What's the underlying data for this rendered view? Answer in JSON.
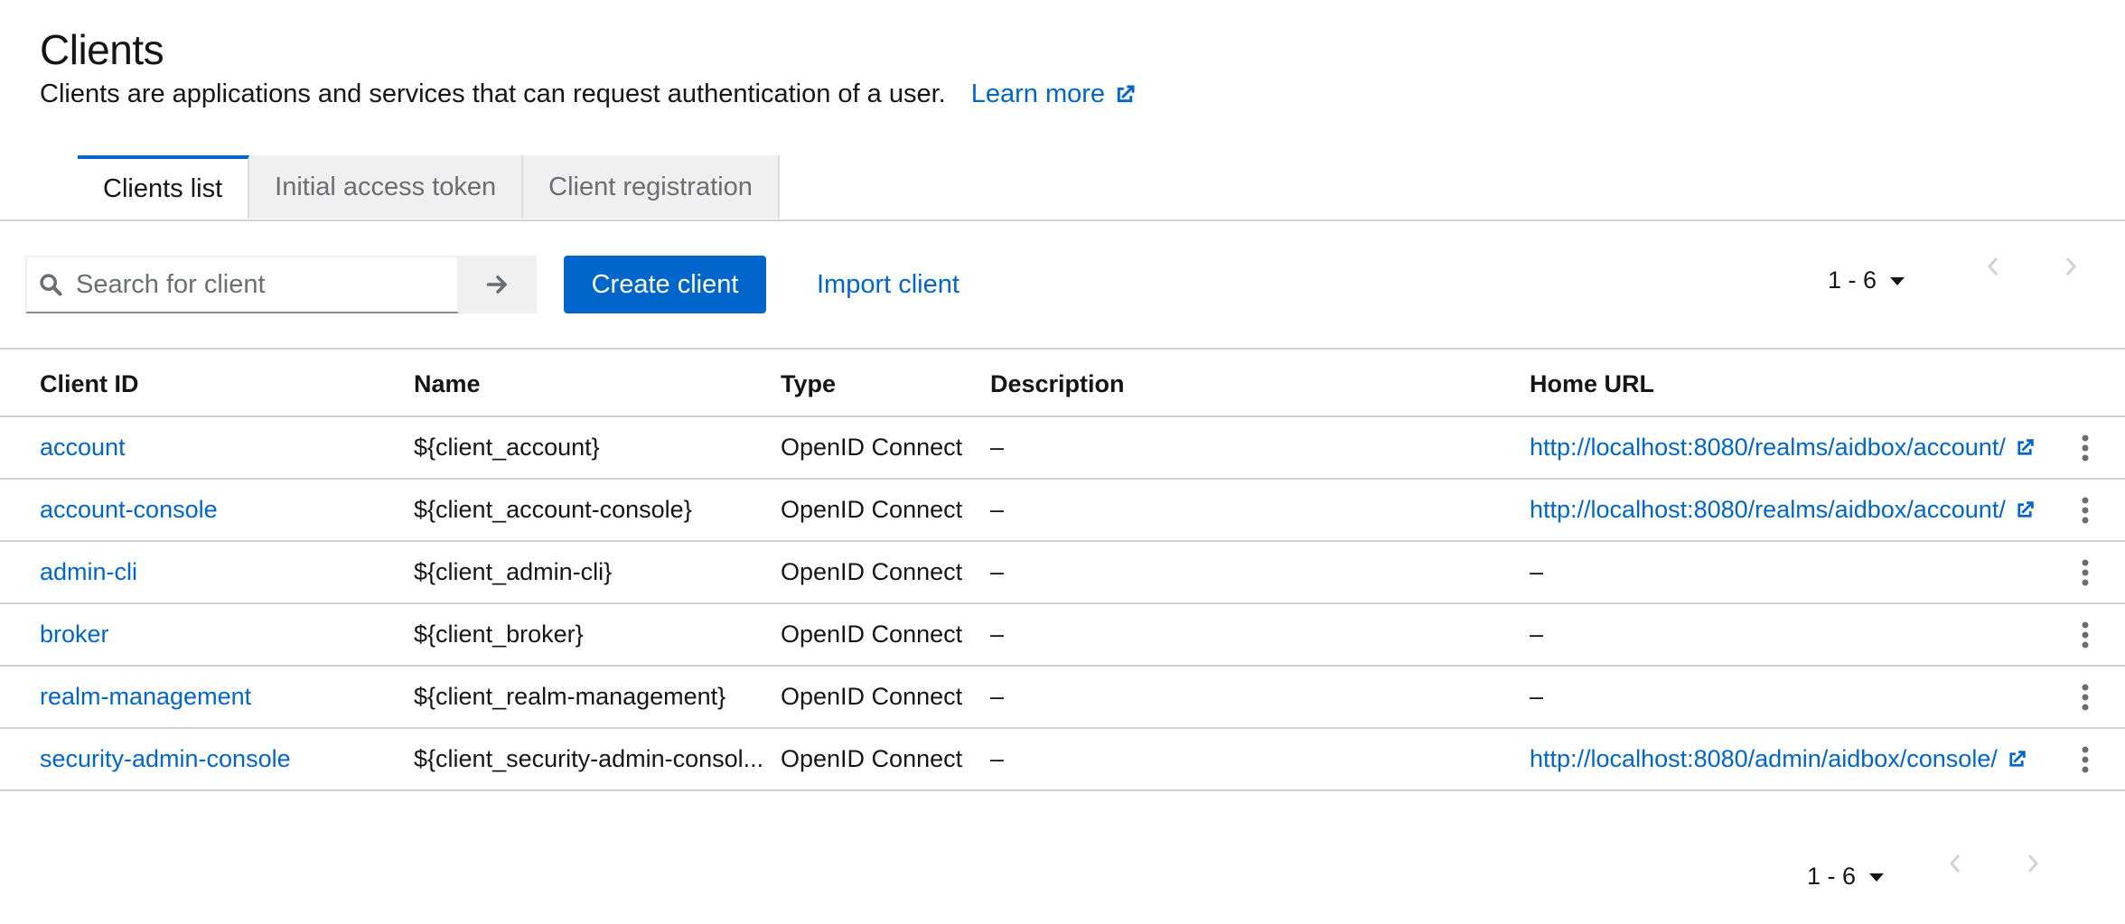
{
  "page": {
    "title": "Clients",
    "subtitle": "Clients are applications and services that can request authentication of a user.",
    "learn_more": "Learn more"
  },
  "tabs": [
    {
      "label": "Clients list",
      "active": true
    },
    {
      "label": "Initial access token",
      "active": false
    },
    {
      "label": "Client registration",
      "active": false
    }
  ],
  "toolbar": {
    "search_placeholder": "Search for client",
    "search_value": "",
    "create_label": "Create client",
    "import_label": "Import client",
    "pagination": "1 - 6"
  },
  "table": {
    "columns": [
      "Client ID",
      "Name",
      "Type",
      "Description",
      "Home URL"
    ],
    "rows": [
      {
        "client_id": "account",
        "name": "${client_account}",
        "type": "OpenID Connect",
        "description": "–",
        "home_url": "http://localhost:8080/realms/aidbox/account/",
        "home_is_link": true
      },
      {
        "client_id": "account-console",
        "name": "${client_account-console}",
        "type": "OpenID Connect",
        "description": "–",
        "home_url": "http://localhost:8080/realms/aidbox/account/",
        "home_is_link": true
      },
      {
        "client_id": "admin-cli",
        "name": "${client_admin-cli}",
        "type": "OpenID Connect",
        "description": "–",
        "home_url": "–",
        "home_is_link": false
      },
      {
        "client_id": "broker",
        "name": "${client_broker}",
        "type": "OpenID Connect",
        "description": "–",
        "home_url": "–",
        "home_is_link": false
      },
      {
        "client_id": "realm-management",
        "name": "${client_realm-management}",
        "type": "OpenID Connect",
        "description": "–",
        "home_url": "–",
        "home_is_link": false
      },
      {
        "client_id": "security-admin-console",
        "name": "${client_security-admin-consol...",
        "type": "OpenID Connect",
        "description": "–",
        "home_url": "http://localhost:8080/admin/aidbox/console/",
        "home_is_link": true
      }
    ]
  },
  "footer": {
    "pagination": "1 - 6"
  },
  "colors": {
    "accent": "#0066cc",
    "text": "#151515",
    "muted": "#6a6e73",
    "border": "#d2d2d2",
    "tab_bg": "#f0f0f0"
  },
  "icons": {
    "external_link": "external-link-icon",
    "search": "search-icon",
    "arrow": "arrow-right-icon",
    "caret": "caret-down-icon",
    "kebab": "kebab-icon"
  }
}
